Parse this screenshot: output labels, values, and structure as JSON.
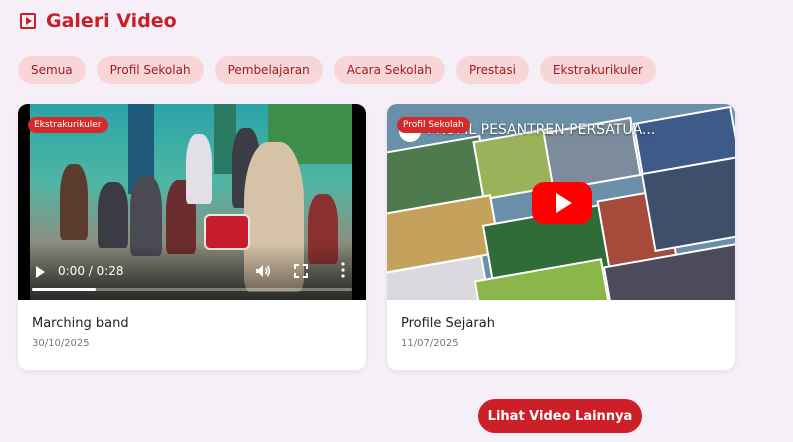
{
  "header": {
    "title": "Galeri Video",
    "icon": "play-square-icon",
    "accent": "#c8202a"
  },
  "filters": [
    "Semua",
    "Profil Sekolah",
    "Pembelajaran",
    "Acara Sekolah",
    "Prestasi",
    "Ekstrakurikuler"
  ],
  "videos": [
    {
      "badge": "Ekstrakurikuler",
      "title": "Marching band",
      "date": "30/10/2025",
      "player": {
        "time": "0:00 / 0:28",
        "progress": 0.2
      }
    },
    {
      "badge": "Profil Sekolah",
      "title": "Profile Sejarah",
      "date": "11/07/2025",
      "embed_title": "PROFIL PESANTREN PERSATUA..."
    }
  ],
  "more_button": "Lihat Video Lainnya"
}
